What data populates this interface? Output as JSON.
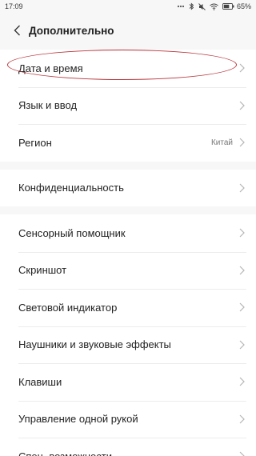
{
  "status_bar": {
    "time": "17:09",
    "battery": "65%"
  },
  "header": {
    "title": "Дополнительно",
    "back_icon": "chevron-left-icon"
  },
  "groups": [
    {
      "items": [
        {
          "label": "Дата и время",
          "value": ""
        },
        {
          "label": "Язык и ввод",
          "value": ""
        },
        {
          "label": "Регион",
          "value": "Китай"
        }
      ]
    },
    {
      "items": [
        {
          "label": "Конфиденциальность",
          "value": ""
        }
      ]
    },
    {
      "items": [
        {
          "label": "Сенсорный помощник",
          "value": ""
        },
        {
          "label": "Скриншот",
          "value": ""
        },
        {
          "label": "Световой индикатор",
          "value": ""
        },
        {
          "label": "Наушники и звуковые эффекты",
          "value": ""
        },
        {
          "label": "Клавиши",
          "value": ""
        },
        {
          "label": "Управление одной рукой",
          "value": ""
        },
        {
          "label": "Спец. возможности",
          "value": ""
        }
      ]
    }
  ],
  "annotation": {
    "color": "#b8333a",
    "target": "Дата и время"
  }
}
